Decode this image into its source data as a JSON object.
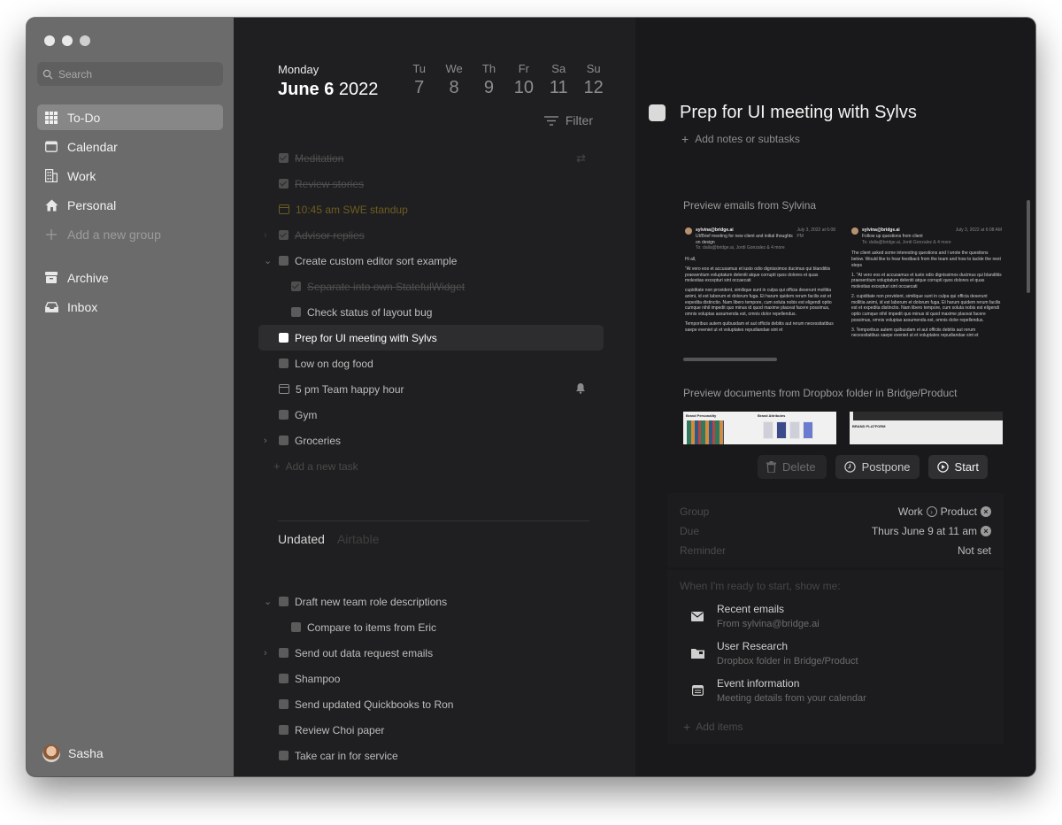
{
  "sidebar": {
    "search_placeholder": "Search",
    "nav": [
      {
        "label": "To-Do",
        "icon": "grid-icon",
        "active": true
      },
      {
        "label": "Calendar",
        "icon": "calendar-icon"
      },
      {
        "label": "Work",
        "icon": "building-icon"
      },
      {
        "label": "Personal",
        "icon": "home-icon"
      },
      {
        "label": "Add a new group",
        "icon": "plus-icon"
      }
    ],
    "nav2": [
      {
        "label": "Archive",
        "icon": "archive-icon"
      },
      {
        "label": "Inbox",
        "icon": "inbox-icon"
      }
    ],
    "user": "Sasha"
  },
  "header": {
    "day_name": "Monday",
    "date_bold": "June 6",
    "year": "2022",
    "week": [
      {
        "dn": "Tu",
        "dd": "7"
      },
      {
        "dn": "We",
        "dd": "8"
      },
      {
        "dn": "Th",
        "dd": "9"
      },
      {
        "dn": "Fr",
        "dd": "10"
      },
      {
        "dn": "Sa",
        "dd": "11"
      },
      {
        "dn": "Su",
        "dd": "12"
      }
    ],
    "filter_label": "Filter"
  },
  "tasks": [
    {
      "label": "Meditation",
      "done": true
    },
    {
      "label": "Review stories",
      "done": true
    },
    {
      "label": "10:45 am SWE standup",
      "event": true
    },
    {
      "label": "Advisor replies",
      "done": true
    },
    {
      "label": "Create custom editor sort example"
    },
    {
      "label": "Separate into own StatefulWidget"
    },
    {
      "label": "Check status of layout bug"
    },
    {
      "label": "Prep for UI meeting with Sylvs"
    },
    {
      "label": "Low on dog food"
    },
    {
      "label": "5 pm Team happy hour"
    },
    {
      "label": "Gym"
    },
    {
      "label": "Groceries"
    },
    {
      "label": "Add a new task"
    }
  ],
  "tabs": {
    "undated": "Undated",
    "airtable": "Airtable"
  },
  "tasks2": [
    {
      "label": "Draft new team role descriptions"
    },
    {
      "label": "Compare to items from Eric"
    },
    {
      "label": "Send out data request emails"
    },
    {
      "label": "Shampoo"
    },
    {
      "label": "Send updated Quickbooks to Ron"
    },
    {
      "label": "Review Choi paper"
    },
    {
      "label": "Take car in for service"
    }
  ],
  "detail": {
    "title": "Prep for UI meeting with Sylvs",
    "add_notes": "Add notes or subtasks",
    "emails_label": "Preview emails from Sylvina",
    "email1": {
      "from": "sylvina@bridge.ai",
      "date": "July 3, 2022 at 6:08 PM",
      "subject": "UI/Brief meeting for new client and initial thoughts on design",
      "to": "To: dalia@bridge.ai, Jordi Gonzalez & 4 more",
      "greeting": "Hi all,",
      "p1": "\"At vero eos et accusamus et iusto odio dignissimos ducimus qui blanditiis praesentium voluptatum deleniti atque corrupti quos dolores et quas molestias excepturi sint occaecati",
      "p2": "cupiditate non provident, similique sunt in culpa qui officia deserunt mollitia animi, id est laborum et dolorum fuga. Et harum quidem rerum facilis est et expedita distinctio. Nam libero tempore, cum soluta nobis est eligendi optio cumque nihil impedit quo minus id quod maxime placeat facere possimus, omnis voluptas assumenda est, omnis dolor repellendus.",
      "p3": "Temporibus autem quibusdam et aut officiis debitis aut rerum necessitatibus saepe eveniet ut et voluptates repudiandae sint et"
    },
    "email2": {
      "from": "sylvina@bridge.ai",
      "date": "July 3, 2022 at 6:08 AM",
      "subject": "Follow up questions from client",
      "to": "To: dalia@bridge.ai, Jordi Gonzalez & 4 more",
      "p1": "The client asked some interesting questions and I wrote the questions below. Would like to hear feedback from the team and how to tackle the next steps",
      "li1": "\"At vero eos et accusamus et iusto odio dignissimos ducimus qui blanditiis praesentium voluptatum deleniti atque corrupti quos dolores et quas molestias excepturi sint occaecati",
      "li2": "cupiditate non provident, similique sunt in culpa qui officia deserunt mollitia animi, id est laborum et dolorum fuga. Et harum quidem rerum facilis est et expedita distinctio. Nam libero tempore, cum soluta nobis est eligendi optio cumque nihil impedit quo minus id quod maxime placeat facere possimus, omnis voluptas assumenda est, omnis dolor repellendus.",
      "li3": "Temporibus autem quibusdam et aut officiis debitis aut rerum necessitatibus saepe eveniet ut et voluptates repudiandae sint et"
    },
    "docs_label": "Preview documents from Dropbox folder in Bridge/Product",
    "doc1_title": "Brand Personality",
    "doc1_title2": "Brand Attributes",
    "doc2_title": "BRAND PLATFORM",
    "delete_label": "Delete",
    "postpone_label": "Postpone",
    "start_label": "Start",
    "meta": {
      "group_key": "Group",
      "group_val1": "Work",
      "group_val2": "Product",
      "due_key": "Due",
      "due_val": "Thurs June 9 at 11 am",
      "reminder_key": "Reminder",
      "reminder_val": "Not set"
    },
    "ready_header": "When I'm ready to start, show me:",
    "ready_items": [
      {
        "title": "Recent emails",
        "sub": "From sylvina@bridge.ai",
        "icon": "mail-icon"
      },
      {
        "title": "User Research",
        "sub": "Dropbox folder in Bridge/Product",
        "icon": "folder-icon"
      },
      {
        "title": "Event information",
        "sub": "Meeting details from your calendar",
        "icon": "calendar-icon"
      }
    ],
    "add_items": "Add items"
  },
  "colors": {
    "selected_row": "#2d2d30",
    "event_text": "#6e5c20",
    "sidebar": "#6b6b6b"
  }
}
